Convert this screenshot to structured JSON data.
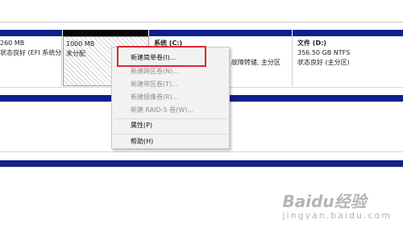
{
  "disk_row": {
    "partitions": [
      {
        "size": "260 MB",
        "status": "状态良好 (EFI 系统分"
      },
      {
        "size": "1000 MB",
        "status": "未分配"
      },
      {
        "name": "系统 (C:)",
        "status": "状态良好 (启动, 页面文件, 故障转储, 主分区"
      },
      {
        "name": "文件 (D:)",
        "size": "356.50 GB NTFS",
        "status": "状态良好 (主分区)"
      }
    ]
  },
  "context_menu": {
    "items": [
      {
        "label": "新建简单卷(I)...",
        "enabled": true
      },
      {
        "label": "新建跨区卷(N)...",
        "enabled": false
      },
      {
        "label": "新建带区卷(T)...",
        "enabled": false
      },
      {
        "label": "新建镜像卷(R)...",
        "enabled": false
      },
      {
        "label": "新建 RAID-5 卷(W)...",
        "enabled": false
      },
      {
        "label": "属性(P)",
        "enabled": true
      },
      {
        "label": "帮助(H)",
        "enabled": true
      }
    ]
  },
  "watermark": {
    "logo": "Baidu经验",
    "sub": "jingyan.baidu.com"
  },
  "colors": {
    "volume_bar": "#0f1f8c",
    "unallocated_bar": "#080808",
    "highlight_box": "#e0262b",
    "menu_bg": "#f2f2f2"
  }
}
